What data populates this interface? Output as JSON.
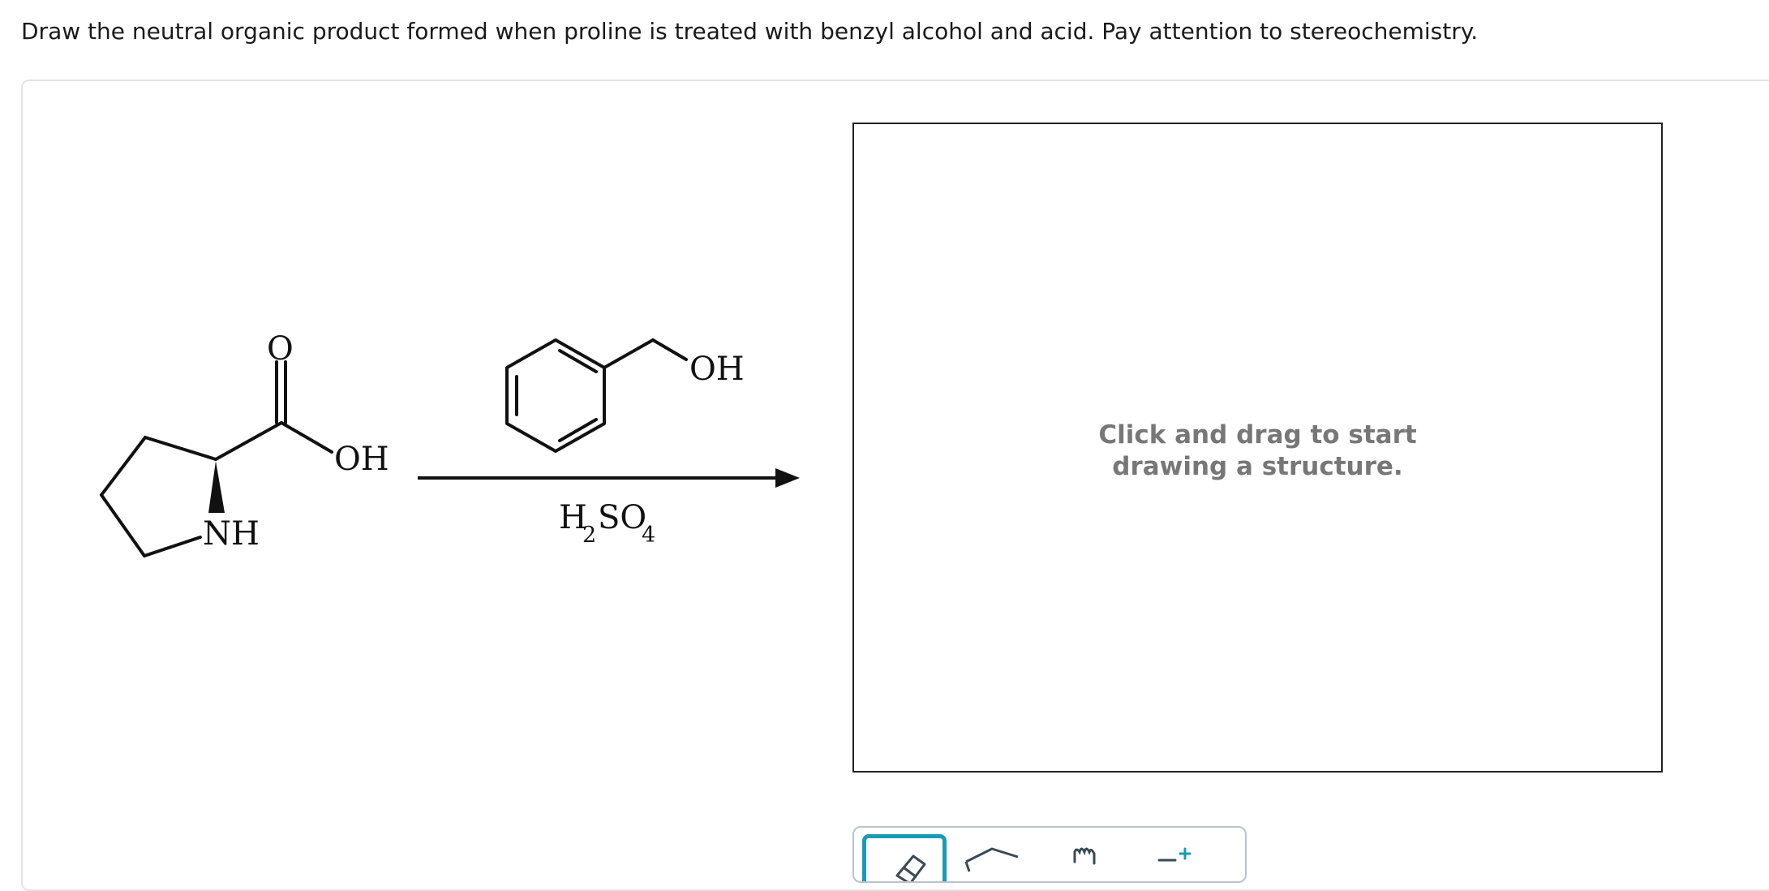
{
  "question": {
    "text": "Draw the neutral organic product formed when proline is treated with benzyl alcohol and acid. Pay attention to stereochemistry."
  },
  "reaction": {
    "reactant_labels": {
      "carbonyl_oxygen": "O",
      "acid_hydroxyl": "OH",
      "amine": "NH"
    },
    "reagent_labels": {
      "benzyl_hydroxyl": "OH"
    },
    "conditions": {
      "h": "H",
      "h_subscript": "2",
      "so": "SO",
      "o_subscript": "4"
    }
  },
  "drawing_area": {
    "hint_line1": "Click and drag to start",
    "hint_line2": "drawing a structure."
  },
  "toolbar": {
    "tools": [
      {
        "icon": "eraser-icon",
        "active": true
      },
      {
        "icon": "lasso-icon",
        "active": false
      },
      {
        "icon": "hand-move-icon",
        "active": false
      },
      {
        "icon": "charge-plus-icon",
        "active": false
      }
    ],
    "accent_color": "#1a9bb3"
  }
}
